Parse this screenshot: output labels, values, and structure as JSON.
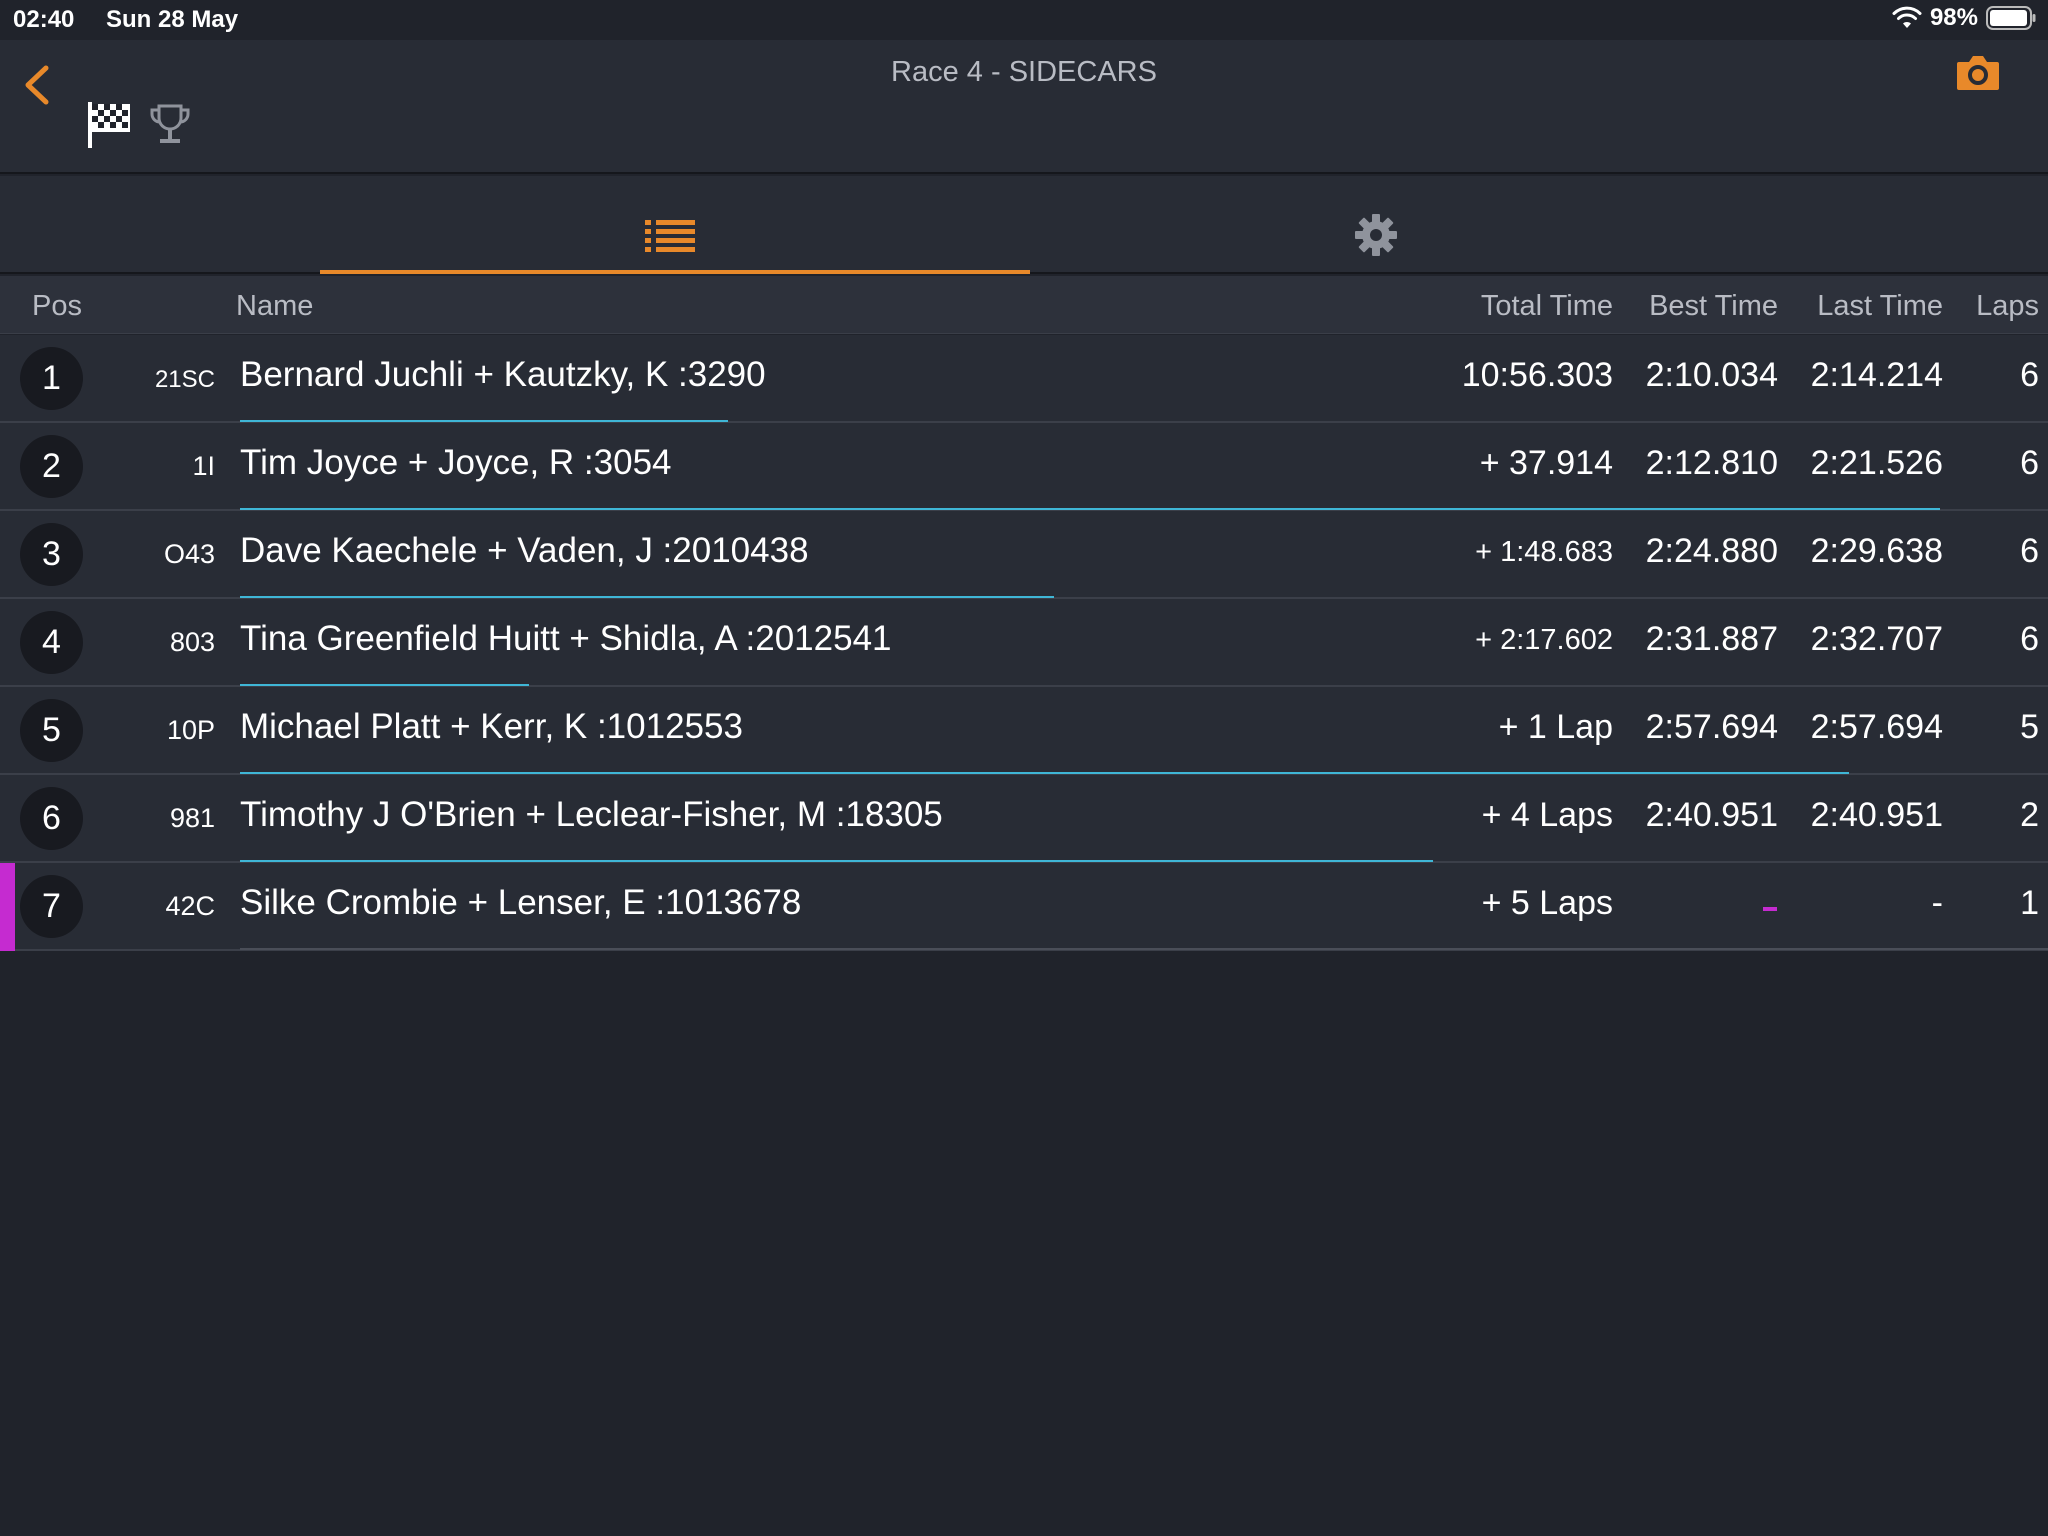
{
  "status_bar": {
    "time": "02:40",
    "date": "Sun 28 May",
    "battery": "98%"
  },
  "nav": {
    "title": "Race 4 - SIDECARS",
    "icons": [
      "back-chevron-icon",
      "checkered-flag-icon",
      "trophy-icon",
      "camera-icon"
    ]
  },
  "tabs": [
    {
      "name": "list-icon",
      "active": true
    },
    {
      "name": "gear-icon",
      "active": false
    }
  ],
  "table": {
    "headers": {
      "pos": "Pos",
      "name": "Name",
      "total": "Total Time",
      "best": "Best Time",
      "last": "Last Time",
      "laps": "Laps"
    },
    "rows": [
      {
        "pos": "1",
        "number": "21SC",
        "name": "Bernard Juchli + Kautzky, K :3290",
        "total": "10:56.303",
        "best": "2:10.034",
        "last": "2:14.214",
        "laps": "6",
        "progress": 0.27
      },
      {
        "pos": "2",
        "number": "1I",
        "name": "Tim Joyce + Joyce, R :3054",
        "total": "+ 37.914",
        "best": "2:12.810",
        "last": "2:21.526",
        "laps": "6",
        "progress": 0.94
      },
      {
        "pos": "3",
        "number": "O43",
        "name": "Dave Kaechele + Vaden, J :2010438",
        "total": "+ 1:48.683",
        "best": "2:24.880",
        "last": "2:29.638",
        "laps": "6",
        "progress": 0.45
      },
      {
        "pos": "4",
        "number": "803",
        "name": "Tina Greenfield Huitt + Shidla, A :2012541",
        "total": "+ 2:17.602",
        "best": "2:31.887",
        "last": "2:32.707",
        "laps": "6",
        "progress": 0.16
      },
      {
        "pos": "5",
        "number": "10P",
        "name": "Michael Platt + Kerr, K :1012553",
        "total": "+ 1 Lap",
        "best": "2:57.694",
        "last": "2:57.694",
        "laps": "5",
        "progress": 0.89
      },
      {
        "pos": "6",
        "number": "981",
        "name": "Timothy J O'Brien + Leclear-Fisher, M :18305",
        "total": "+ 4 Laps",
        "best": "2:40.951",
        "last": "2:40.951",
        "laps": "2",
        "progress": 0.66
      },
      {
        "pos": "7",
        "number": "42C",
        "name": "Silke Crombie + Lenser, E :1013678",
        "total": "+ 5 Laps",
        "best": "",
        "last": "-",
        "laps": "1",
        "progress": 0
      }
    ]
  },
  "colors": {
    "accent": "#e8892a",
    "progress": "#3fb6d6",
    "highlight": "#c52bd0",
    "background": "#20232b",
    "row": "#282c35"
  }
}
